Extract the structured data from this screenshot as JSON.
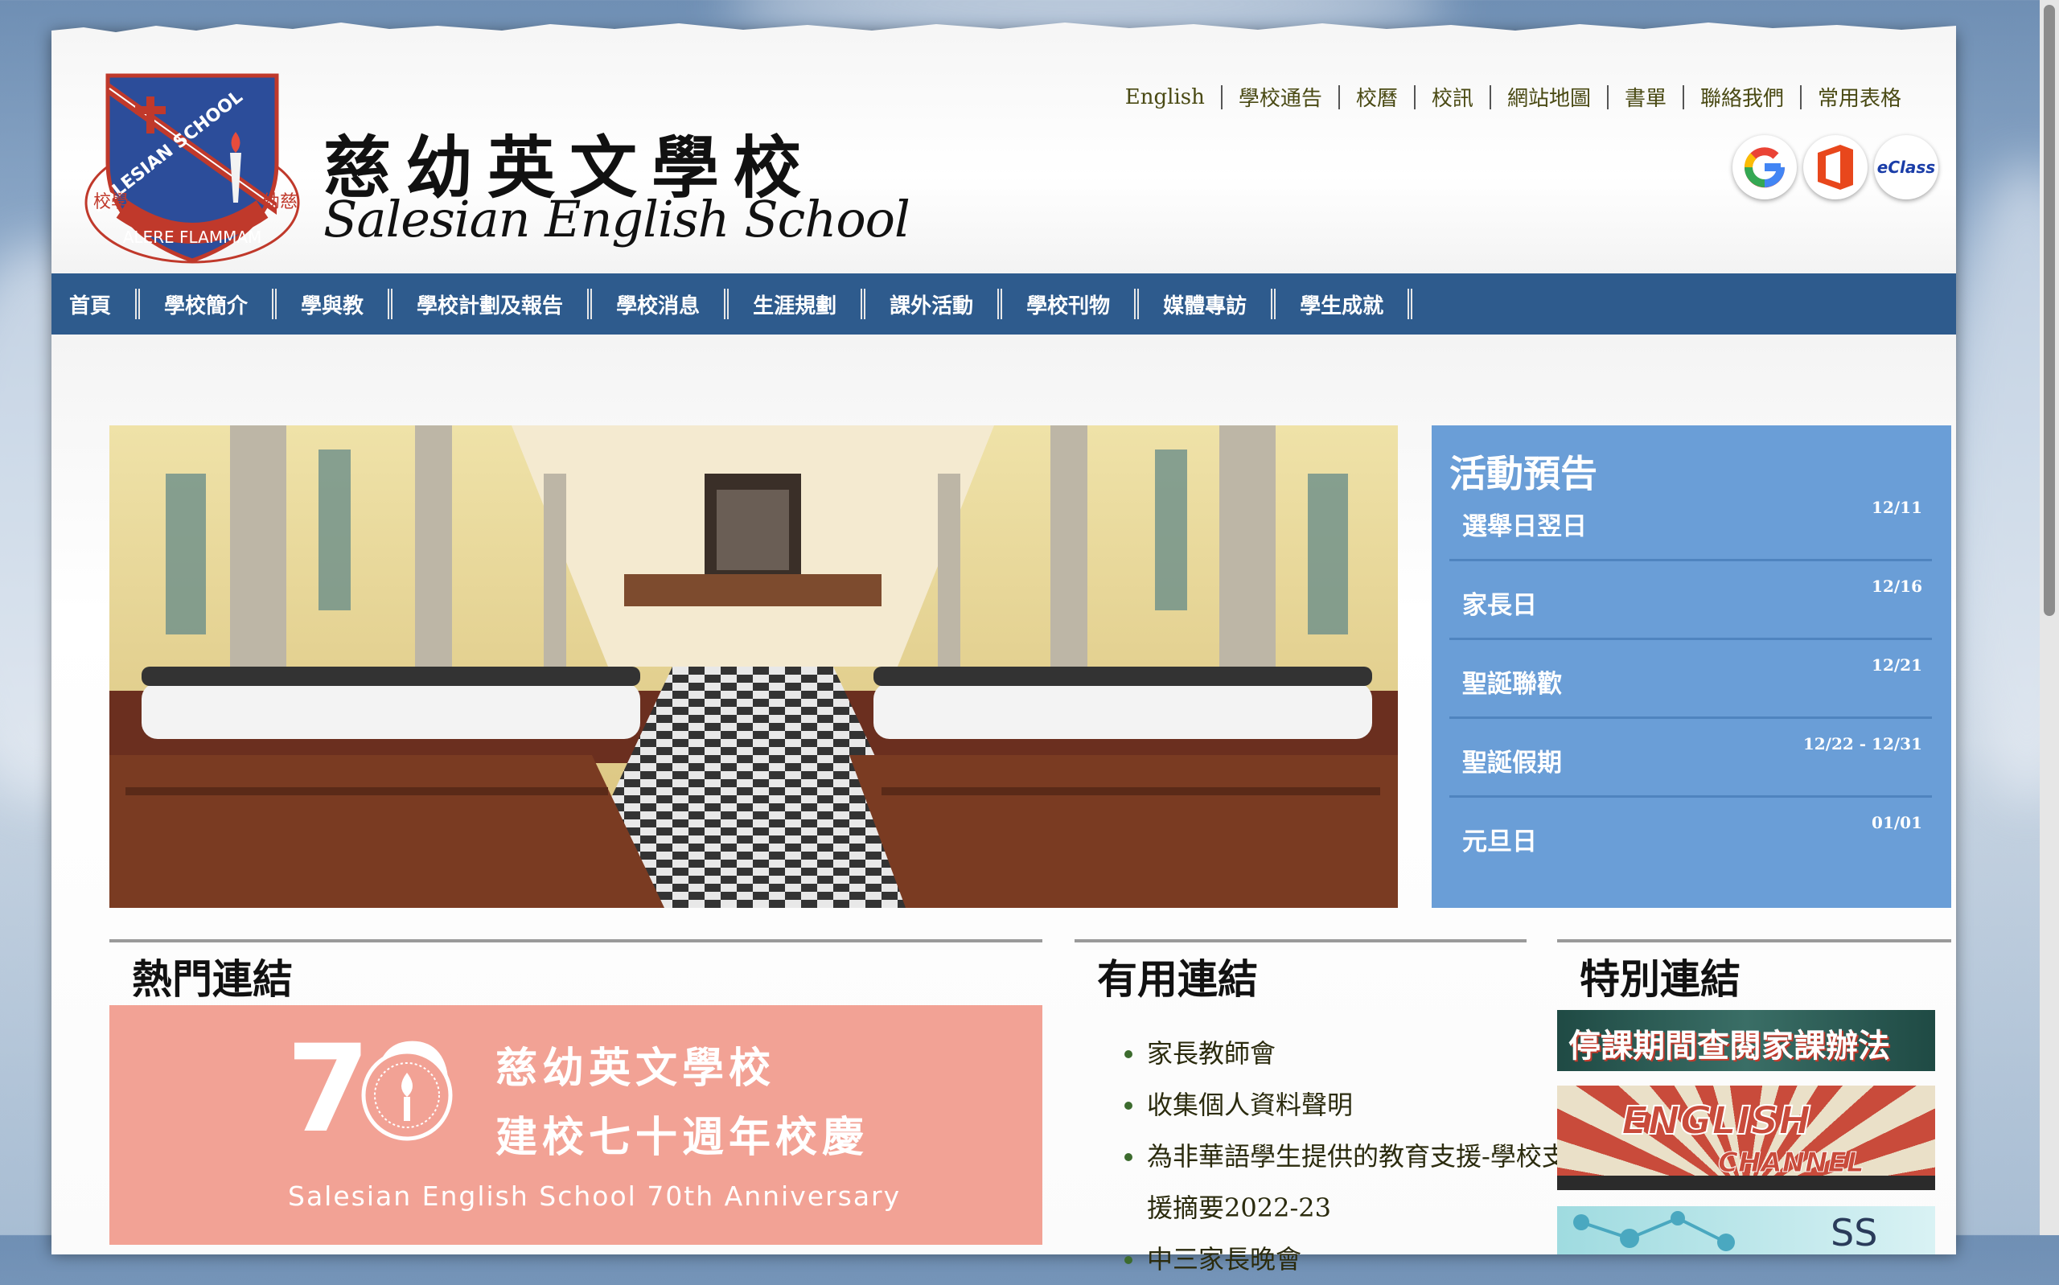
{
  "school": {
    "name_zh": "慈幼英文學校",
    "name_en": "Salesian English School",
    "crest_text_outer": "SALESIAN SCHOOL",
    "crest_motto": "ALERE FLAMMAM",
    "crest_zh_left": "校學",
    "crest_zh_right": "幼慈"
  },
  "toplinks": [
    "English",
    "學校通告",
    "校曆",
    "校訊",
    "網站地圖",
    "書單",
    "聯絡我們",
    "常用表格"
  ],
  "app_icons": [
    {
      "name": "google-icon",
      "color": "#4285f4"
    },
    {
      "name": "office-icon",
      "color": "#e8471c"
    },
    {
      "name": "eclass-icon",
      "color": "#1a3da8",
      "label": "eClass"
    }
  ],
  "nav": [
    "首頁",
    "學校簡介",
    "學與教",
    "學校計劃及報告",
    "學校消息",
    "生涯規劃",
    "課外活動",
    "學校刊物",
    "媒體專訪",
    "學生成就"
  ],
  "events": {
    "title": "活動預告",
    "items": [
      {
        "name": "選舉日翌日",
        "date": "12/11"
      },
      {
        "name": "家長日",
        "date": "12/16"
      },
      {
        "name": "聖誕聯歡",
        "date": "12/21"
      },
      {
        "name": "聖誕假期",
        "date": "12/22 - 12/31"
      },
      {
        "name": "元旦日",
        "date": "01/01"
      }
    ]
  },
  "sections": {
    "hot": {
      "title": "熱門連結",
      "banner": {
        "big_number": "70",
        "line1": "慈幼英文學校",
        "line2": "建校七十週年校慶",
        "line3": "Salesian English School 70th Anniversary"
      }
    },
    "useful": {
      "title": "有用連結",
      "items": [
        "家長教師會",
        "收集個人資料聲明",
        "為非華語學生提供的教育支援-學校支援摘要2022-23",
        "中三家長晚會"
      ]
    },
    "special": {
      "title": "特別連結",
      "banners": [
        "停課期間查閱家課辦法",
        "ENGLISH",
        "CHANNEL",
        "SS"
      ]
    }
  },
  "colors": {
    "nav_bg": "#2e5b8d",
    "events_bg": "#6a9ed7",
    "banner70_bg": "#f2a295"
  }
}
